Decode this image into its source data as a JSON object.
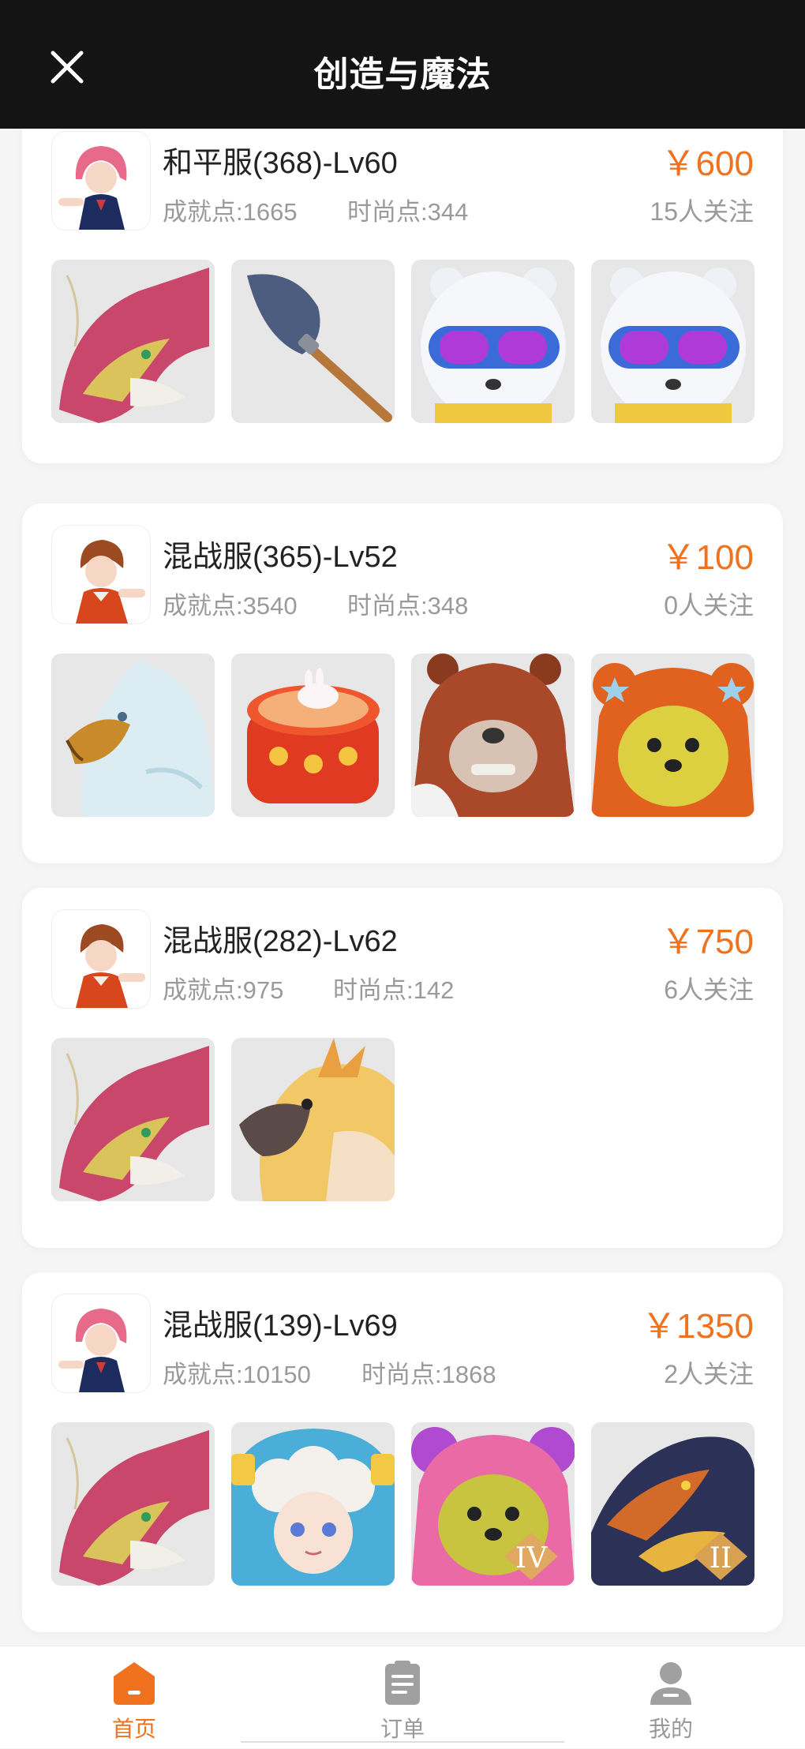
{
  "header": {
    "title": "创造与魔法"
  },
  "listings": [
    {
      "title": "和平服(368)-Lv60",
      "achievement": "成就点:1665",
      "fashion": "时尚点:344",
      "price": "￥600",
      "followers": "15人关注",
      "avatar_icon": "pink-hair-girl-avatar",
      "items": [
        "pink-dragon-mount",
        "shovel-tool",
        "goggle-bear",
        "goggle-bear"
      ]
    },
    {
      "title": "混战服(365)-Lv52",
      "achievement": "成就点:3540",
      "fashion": "时尚点:348",
      "price": "￥100",
      "followers": "0人关注",
      "avatar_icon": "brown-hair-boy-avatar",
      "items": [
        "white-eagle-mount",
        "red-drum-with-bunny",
        "brown-bear-mount",
        "orange-bear-suit"
      ]
    },
    {
      "title": "混战服(282)-Lv62",
      "achievement": "成就点:975",
      "fashion": "时尚点:142",
      "price": "￥750",
      "followers": "6人关注",
      "avatar_icon": "brown-hair-boy-avatar",
      "items": [
        "pink-dragon-mount",
        "golden-parrot-mount"
      ]
    },
    {
      "title": "混战服(139)-Lv69",
      "achievement": "成就点:10150",
      "fashion": "时尚点:1868",
      "price": "￥1350",
      "followers": "2人关注",
      "avatar_icon": "pink-hair-girl-avatar",
      "items": [
        "pink-dragon-mount",
        "sheep-hair-girl",
        "pink-bear-suit",
        "dark-dragon-mount"
      ],
      "item_badges": [
        "",
        "",
        "IV",
        "II"
      ]
    }
  ],
  "tabbar": {
    "items": [
      {
        "label": "首页",
        "icon": "home-icon",
        "active": true
      },
      {
        "label": "订单",
        "icon": "clipboard-icon",
        "active": false
      },
      {
        "label": "我的",
        "icon": "user-icon",
        "active": false
      }
    ],
    "active_color": "#f0721e",
    "inactive_color": "#999999"
  },
  "colors": {
    "price": "#f0721e",
    "header_bg": "#141414"
  }
}
